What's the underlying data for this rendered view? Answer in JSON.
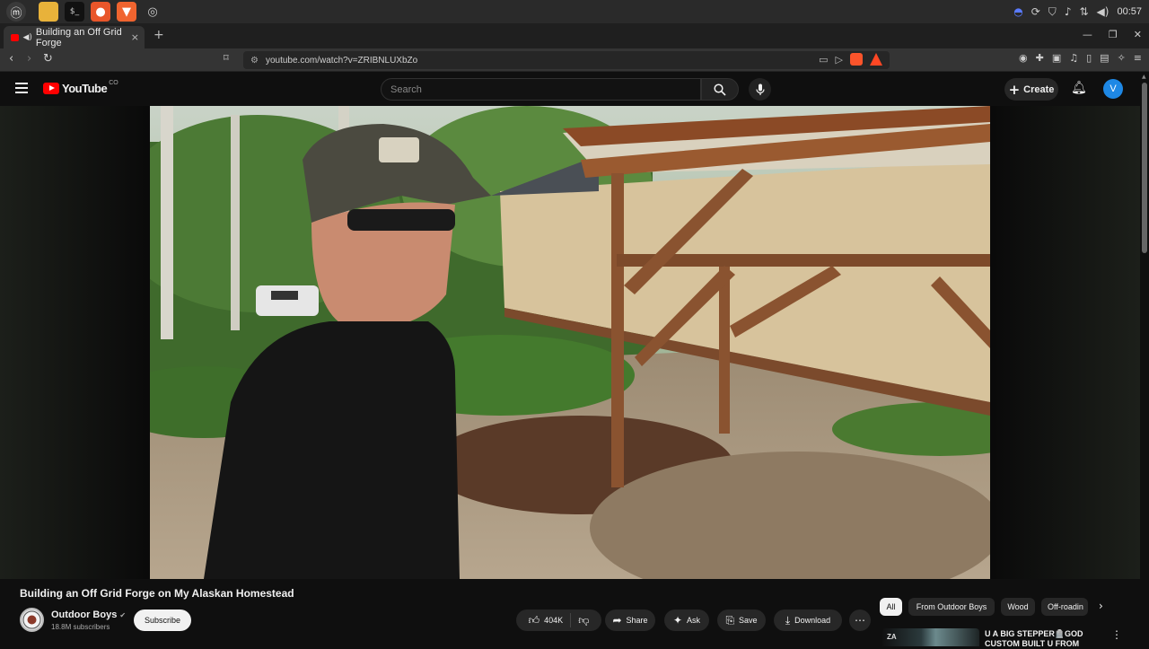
{
  "taskbar": {
    "clock": "00:57"
  },
  "browser": {
    "tab_title": "Building an Off Grid Forge",
    "url": "youtube.com/watch?v=ZRIBNLUXbZo",
    "new_tab_icon": "plus-icon"
  },
  "youtube": {
    "logo_text": "YouTube",
    "logo_suffix": "CO",
    "search_placeholder": "Search",
    "create_label": "Create",
    "avatar_letter": "V"
  },
  "video": {
    "title": "Building an Off Grid Forge on My Alaskan Homestead",
    "channel_name": "Outdoor Boys",
    "subscribers": "18.8M subscribers",
    "subscribe_label": "Subscribe",
    "likes": "404K",
    "actions": {
      "share": "Share",
      "ask": "Ask",
      "save": "Save",
      "download": "Download"
    }
  },
  "chips": [
    "All",
    "From Outdoor Boys",
    "Wood",
    "Off-roadin"
  ],
  "recommendation": {
    "badge": "ZA",
    "title": "U A BIG STEPPER🪦GOD CUSTOM BUILT U FROM"
  },
  "colors": {
    "youtube_red": "#ff0000",
    "background": "#0f0f0f",
    "avatar_blue": "#1e88e5"
  }
}
